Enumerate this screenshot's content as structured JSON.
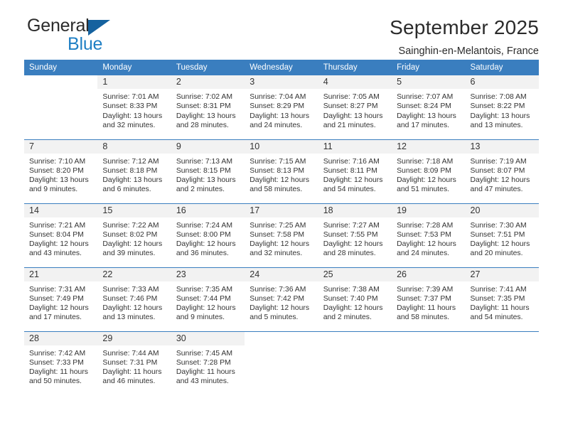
{
  "brand": {
    "name_top": "General",
    "name_bottom": "Blue",
    "accent_color": "#1f7fc4",
    "triangle_color": "#15629f"
  },
  "header": {
    "title": "September 2025",
    "subtitle": "Sainghin-en-Melantois, France"
  },
  "theme": {
    "header_row_bg": "#3a7ebf",
    "daynum_bg": "#f2f2f2",
    "text_color": "#333333"
  },
  "weekday_headers": [
    "Sunday",
    "Monday",
    "Tuesday",
    "Wednesday",
    "Thursday",
    "Friday",
    "Saturday"
  ],
  "weeks": [
    [
      {
        "day": "",
        "sunrise": "",
        "sunset": "",
        "daylight_line1": "",
        "daylight_line2": ""
      },
      {
        "day": "1",
        "sunrise": "Sunrise: 7:01 AM",
        "sunset": "Sunset: 8:33 PM",
        "daylight_line1": "Daylight: 13 hours",
        "daylight_line2": "and 32 minutes."
      },
      {
        "day": "2",
        "sunrise": "Sunrise: 7:02 AM",
        "sunset": "Sunset: 8:31 PM",
        "daylight_line1": "Daylight: 13 hours",
        "daylight_line2": "and 28 minutes."
      },
      {
        "day": "3",
        "sunrise": "Sunrise: 7:04 AM",
        "sunset": "Sunset: 8:29 PM",
        "daylight_line1": "Daylight: 13 hours",
        "daylight_line2": "and 24 minutes."
      },
      {
        "day": "4",
        "sunrise": "Sunrise: 7:05 AM",
        "sunset": "Sunset: 8:27 PM",
        "daylight_line1": "Daylight: 13 hours",
        "daylight_line2": "and 21 minutes."
      },
      {
        "day": "5",
        "sunrise": "Sunrise: 7:07 AM",
        "sunset": "Sunset: 8:24 PM",
        "daylight_line1": "Daylight: 13 hours",
        "daylight_line2": "and 17 minutes."
      },
      {
        "day": "6",
        "sunrise": "Sunrise: 7:08 AM",
        "sunset": "Sunset: 8:22 PM",
        "daylight_line1": "Daylight: 13 hours",
        "daylight_line2": "and 13 minutes."
      }
    ],
    [
      {
        "day": "7",
        "sunrise": "Sunrise: 7:10 AM",
        "sunset": "Sunset: 8:20 PM",
        "daylight_line1": "Daylight: 13 hours",
        "daylight_line2": "and 9 minutes."
      },
      {
        "day": "8",
        "sunrise": "Sunrise: 7:12 AM",
        "sunset": "Sunset: 8:18 PM",
        "daylight_line1": "Daylight: 13 hours",
        "daylight_line2": "and 6 minutes."
      },
      {
        "day": "9",
        "sunrise": "Sunrise: 7:13 AM",
        "sunset": "Sunset: 8:15 PM",
        "daylight_line1": "Daylight: 13 hours",
        "daylight_line2": "and 2 minutes."
      },
      {
        "day": "10",
        "sunrise": "Sunrise: 7:15 AM",
        "sunset": "Sunset: 8:13 PM",
        "daylight_line1": "Daylight: 12 hours",
        "daylight_line2": "and 58 minutes."
      },
      {
        "day": "11",
        "sunrise": "Sunrise: 7:16 AM",
        "sunset": "Sunset: 8:11 PM",
        "daylight_line1": "Daylight: 12 hours",
        "daylight_line2": "and 54 minutes."
      },
      {
        "day": "12",
        "sunrise": "Sunrise: 7:18 AM",
        "sunset": "Sunset: 8:09 PM",
        "daylight_line1": "Daylight: 12 hours",
        "daylight_line2": "and 51 minutes."
      },
      {
        "day": "13",
        "sunrise": "Sunrise: 7:19 AM",
        "sunset": "Sunset: 8:07 PM",
        "daylight_line1": "Daylight: 12 hours",
        "daylight_line2": "and 47 minutes."
      }
    ],
    [
      {
        "day": "14",
        "sunrise": "Sunrise: 7:21 AM",
        "sunset": "Sunset: 8:04 PM",
        "daylight_line1": "Daylight: 12 hours",
        "daylight_line2": "and 43 minutes."
      },
      {
        "day": "15",
        "sunrise": "Sunrise: 7:22 AM",
        "sunset": "Sunset: 8:02 PM",
        "daylight_line1": "Daylight: 12 hours",
        "daylight_line2": "and 39 minutes."
      },
      {
        "day": "16",
        "sunrise": "Sunrise: 7:24 AM",
        "sunset": "Sunset: 8:00 PM",
        "daylight_line1": "Daylight: 12 hours",
        "daylight_line2": "and 36 minutes."
      },
      {
        "day": "17",
        "sunrise": "Sunrise: 7:25 AM",
        "sunset": "Sunset: 7:58 PM",
        "daylight_line1": "Daylight: 12 hours",
        "daylight_line2": "and 32 minutes."
      },
      {
        "day": "18",
        "sunrise": "Sunrise: 7:27 AM",
        "sunset": "Sunset: 7:55 PM",
        "daylight_line1": "Daylight: 12 hours",
        "daylight_line2": "and 28 minutes."
      },
      {
        "day": "19",
        "sunrise": "Sunrise: 7:28 AM",
        "sunset": "Sunset: 7:53 PM",
        "daylight_line1": "Daylight: 12 hours",
        "daylight_line2": "and 24 minutes."
      },
      {
        "day": "20",
        "sunrise": "Sunrise: 7:30 AM",
        "sunset": "Sunset: 7:51 PM",
        "daylight_line1": "Daylight: 12 hours",
        "daylight_line2": "and 20 minutes."
      }
    ],
    [
      {
        "day": "21",
        "sunrise": "Sunrise: 7:31 AM",
        "sunset": "Sunset: 7:49 PM",
        "daylight_line1": "Daylight: 12 hours",
        "daylight_line2": "and 17 minutes."
      },
      {
        "day": "22",
        "sunrise": "Sunrise: 7:33 AM",
        "sunset": "Sunset: 7:46 PM",
        "daylight_line1": "Daylight: 12 hours",
        "daylight_line2": "and 13 minutes."
      },
      {
        "day": "23",
        "sunrise": "Sunrise: 7:35 AM",
        "sunset": "Sunset: 7:44 PM",
        "daylight_line1": "Daylight: 12 hours",
        "daylight_line2": "and 9 minutes."
      },
      {
        "day": "24",
        "sunrise": "Sunrise: 7:36 AM",
        "sunset": "Sunset: 7:42 PM",
        "daylight_line1": "Daylight: 12 hours",
        "daylight_line2": "and 5 minutes."
      },
      {
        "day": "25",
        "sunrise": "Sunrise: 7:38 AM",
        "sunset": "Sunset: 7:40 PM",
        "daylight_line1": "Daylight: 12 hours",
        "daylight_line2": "and 2 minutes."
      },
      {
        "day": "26",
        "sunrise": "Sunrise: 7:39 AM",
        "sunset": "Sunset: 7:37 PM",
        "daylight_line1": "Daylight: 11 hours",
        "daylight_line2": "and 58 minutes."
      },
      {
        "day": "27",
        "sunrise": "Sunrise: 7:41 AM",
        "sunset": "Sunset: 7:35 PM",
        "daylight_line1": "Daylight: 11 hours",
        "daylight_line2": "and 54 minutes."
      }
    ],
    [
      {
        "day": "28",
        "sunrise": "Sunrise: 7:42 AM",
        "sunset": "Sunset: 7:33 PM",
        "daylight_line1": "Daylight: 11 hours",
        "daylight_line2": "and 50 minutes."
      },
      {
        "day": "29",
        "sunrise": "Sunrise: 7:44 AM",
        "sunset": "Sunset: 7:31 PM",
        "daylight_line1": "Daylight: 11 hours",
        "daylight_line2": "and 46 minutes."
      },
      {
        "day": "30",
        "sunrise": "Sunrise: 7:45 AM",
        "sunset": "Sunset: 7:28 PM",
        "daylight_line1": "Daylight: 11 hours",
        "daylight_line2": "and 43 minutes."
      },
      {
        "day": "",
        "sunrise": "",
        "sunset": "",
        "daylight_line1": "",
        "daylight_line2": ""
      },
      {
        "day": "",
        "sunrise": "",
        "sunset": "",
        "daylight_line1": "",
        "daylight_line2": ""
      },
      {
        "day": "",
        "sunrise": "",
        "sunset": "",
        "daylight_line1": "",
        "daylight_line2": ""
      },
      {
        "day": "",
        "sunrise": "",
        "sunset": "",
        "daylight_line1": "",
        "daylight_line2": ""
      }
    ]
  ]
}
